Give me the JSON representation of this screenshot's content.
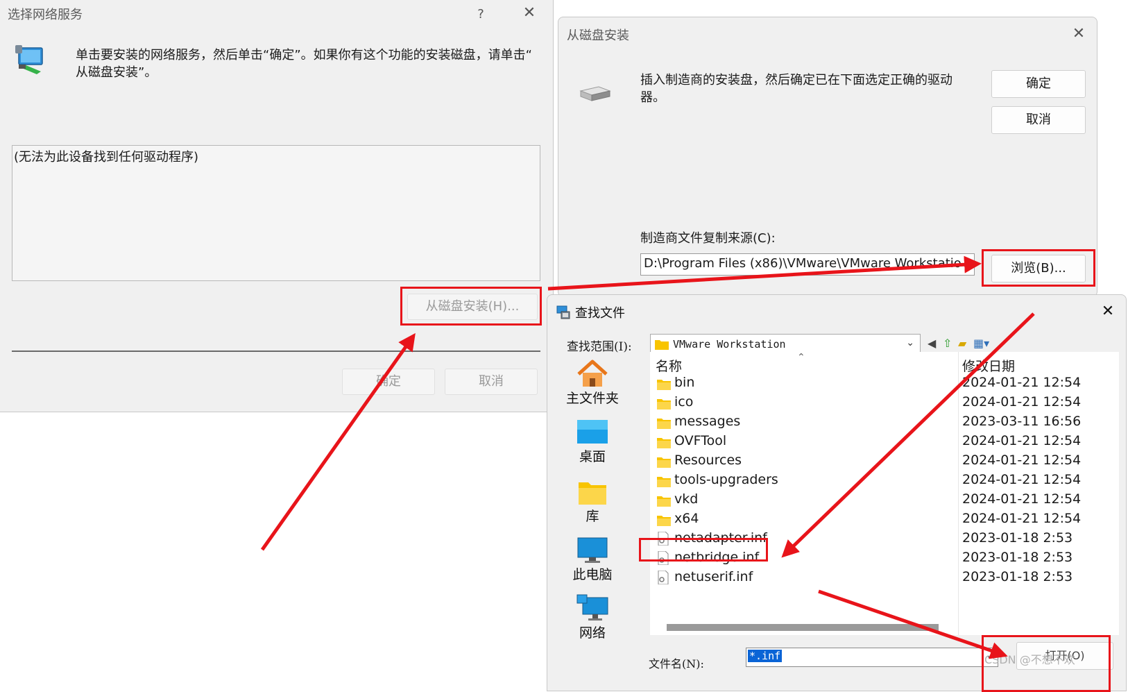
{
  "win1": {
    "title": "选择网络服务",
    "help": "?",
    "close": "✕",
    "instruction_line1": "单击要安装的网络服务，然后单击“确定”。如果你有这个功能的安装磁盘，请单击“",
    "instruction_line2": "从磁盘安装”。",
    "list_text": "(无法为此设备找到任何驱动程序)",
    "have_disk_button": "从磁盘安装(H)...",
    "ok_button": "确定",
    "cancel_button": "取消"
  },
  "win2": {
    "title": "从磁盘安装",
    "close": "✕",
    "instruction_line1": "插入制造商的安装盘，然后确定已在下面选定正确的驱动",
    "instruction_line2": "器。",
    "ok_button": "确定",
    "cancel_button": "取消",
    "copy_from_label": "制造商文件复制来源(C):",
    "path_value": "D:\\Program Files (x86)\\VMware\\VMware Workstatio",
    "browse_button": "浏览(B)..."
  },
  "win3": {
    "title": "查找文件",
    "close": "✕",
    "look_in_label": "查找范围(I):",
    "look_in_value": "VMware Workstation",
    "sidebar": [
      {
        "label": "主文件夹",
        "icon": "home-icon"
      },
      {
        "label": "桌面",
        "icon": "desktop-icon"
      },
      {
        "label": "库",
        "icon": "library-icon"
      },
      {
        "label": "此电脑",
        "icon": "computer-icon"
      },
      {
        "label": "网络",
        "icon": "network-icon"
      }
    ],
    "col_name": "名称",
    "col_date": "修改日期",
    "files": [
      {
        "name": "bin",
        "date": "2024-01-21 12:54",
        "type": "folder"
      },
      {
        "name": "ico",
        "date": "2024-01-21 12:54",
        "type": "folder"
      },
      {
        "name": "messages",
        "date": "2023-03-11 16:56",
        "type": "folder"
      },
      {
        "name": "OVFTool",
        "date": "2024-01-21 12:54",
        "type": "folder"
      },
      {
        "name": "Resources",
        "date": "2024-01-21 12:54",
        "type": "folder"
      },
      {
        "name": "tools-upgraders",
        "date": "2024-01-21 12:54",
        "type": "folder"
      },
      {
        "name": "vkd",
        "date": "2024-01-21 12:54",
        "type": "folder"
      },
      {
        "name": "x64",
        "date": "2024-01-21 12:54",
        "type": "folder"
      },
      {
        "name": "netadapter.inf",
        "date": "2023-01-18 2:53",
        "type": "file"
      },
      {
        "name": "netbridge.inf",
        "date": "2023-01-18 2:53",
        "type": "file"
      },
      {
        "name": "netuserif.inf",
        "date": "2023-01-18 2:53",
        "type": "file"
      }
    ],
    "filename_label": "文件名(N):",
    "filename_value": "*.inf",
    "open_button": "打开(O)",
    "watermark": "CSDN @不想不欢"
  },
  "colors": {
    "highlight_red": "#e8141a",
    "dialog_bg": "#f0f0f0",
    "selection_blue": "#0a64d6"
  }
}
